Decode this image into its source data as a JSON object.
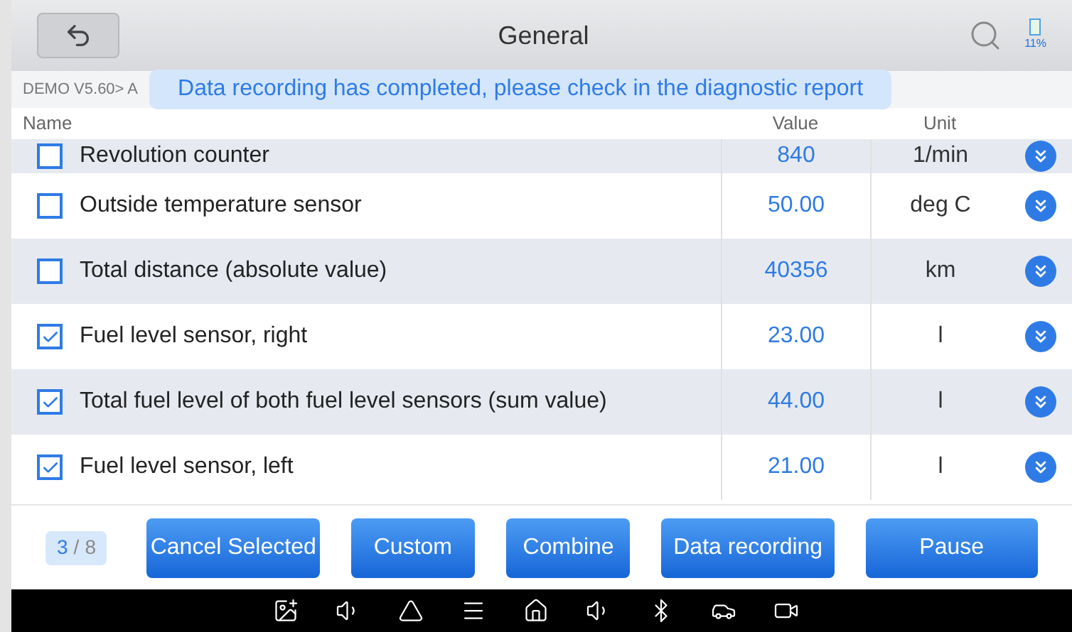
{
  "title": "General",
  "battery": "11%",
  "breadcrumb": "DEMO V5.60> A",
  "toast": "Data recording has completed, please check in the diagnostic report",
  "columns": [
    "Name",
    "Value",
    "Unit"
  ],
  "rows": [
    {
      "name": "Revolution counter",
      "value": "840",
      "unit": "1/min",
      "checked": false
    },
    {
      "name": "Outside temperature sensor",
      "value": "50.00",
      "unit": "deg C",
      "checked": false
    },
    {
      "name": "Total distance (absolute value)",
      "value": "40356",
      "unit": "km",
      "checked": false
    },
    {
      "name": "Fuel level sensor, right",
      "value": "23.00",
      "unit": "l",
      "checked": true
    },
    {
      "name": "Total fuel level of both fuel level sensors (sum value)",
      "value": "44.00",
      "unit": "l",
      "checked": true
    },
    {
      "name": "Fuel level sensor, left",
      "value": "21.00",
      "unit": "l",
      "checked": true
    }
  ],
  "page": {
    "current": "3",
    "separator": "/",
    "total": "8"
  },
  "buttons": [
    "Cancel Selected",
    "Custom",
    "Combine",
    "Data recording",
    "Pause"
  ]
}
